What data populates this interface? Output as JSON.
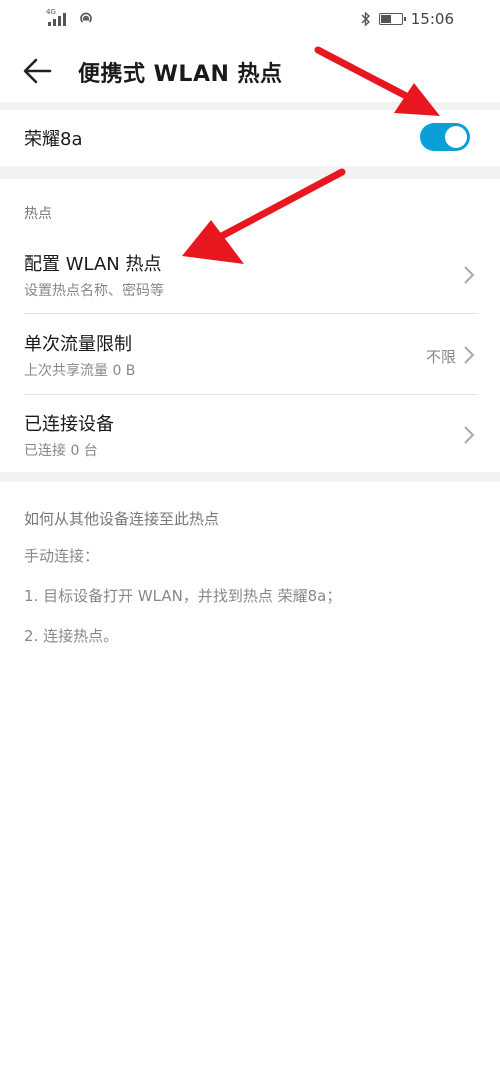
{
  "status_bar": {
    "network": "4G",
    "time": "15:06",
    "battery_level": 0.55
  },
  "header": {
    "title": "便携式 WLAN 热点"
  },
  "hotspot": {
    "name": "荣耀8a",
    "enabled": true
  },
  "section": {
    "label": "热点"
  },
  "items": [
    {
      "title": "配置 WLAN 热点",
      "subtitle": "设置热点名称、密码等",
      "value": ""
    },
    {
      "title": "单次流量限制",
      "subtitle": "上次共享流量 0 B",
      "value": "不限"
    },
    {
      "title": "已连接设备",
      "subtitle": "已连接 0 台",
      "value": ""
    }
  ],
  "help": {
    "title": "如何从其他设备连接至此热点",
    "manual": "手动连接：",
    "step1": "1. 目标设备打开 WLAN，并找到热点 荣耀8a；",
    "step2": "2. 连接热点。"
  },
  "colors": {
    "accent": "#0a9fd6",
    "annotation_arrow": "#e8161f"
  }
}
